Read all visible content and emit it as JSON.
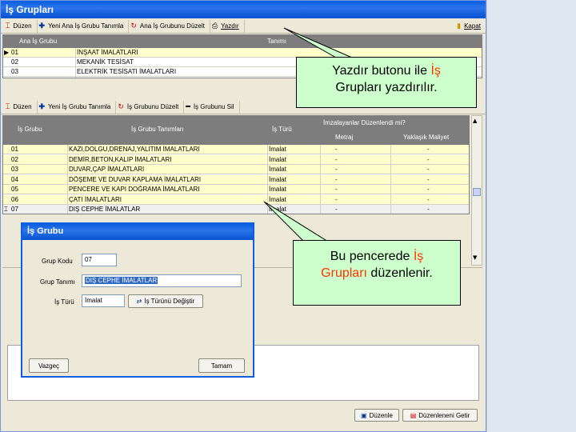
{
  "window": {
    "title": "İş Grupları"
  },
  "toolbar_top": {
    "edit": "Düzen",
    "new_main": "Yeni Ana İş Grubu Tanımla",
    "edit_main": "Ana İş Grubunu Düzelt",
    "print": "Yazdır",
    "close": "Kapat"
  },
  "main_grid": {
    "headers": [
      "Ana İş Grubu",
      "Tanımı"
    ],
    "rows": [
      {
        "code": "01",
        "name": "İNŞAAT İMALATLARI"
      },
      {
        "code": "02",
        "name": "MEKANİK TESİSAT"
      },
      {
        "code": "03",
        "name": "ELEKTRİK TESİSATI İMALATLARI"
      }
    ]
  },
  "toolbar_sub": {
    "edit": "Düzen",
    "new": "Yeni İş Grubu Tanımla",
    "edit_group": "İş Grubunu Düzelt",
    "delete": "İş Grubunu Sil"
  },
  "sub_grid": {
    "headers": {
      "code": "İş Grubu",
      "name": "İş Grubu Tanımları",
      "type": "İş Türü",
      "sign": "İmzalayanlar Düzenlendi mi?",
      "metraj": "Metraj",
      "cost": "Yaklaşık Maliyet"
    },
    "rows": [
      {
        "code": "01",
        "name": "KAZI,DOLGU,DRENAJ,YALITIM İMALATLARI",
        "type": "İmalat",
        "m": "-",
        "c": "-"
      },
      {
        "code": "02",
        "name": "DEMİR,BETON,KALIP İMALATLARI",
        "type": "İmalat",
        "m": "-",
        "c": "-"
      },
      {
        "code": "03",
        "name": "DUVAR,ÇAP İMALATLARI",
        "type": "İmalat",
        "m": "-",
        "c": "-"
      },
      {
        "code": "04",
        "name": "DÖŞEME VE DUVAR KAPLAMA İMALATLARI",
        "type": "İmalat",
        "m": "-",
        "c": "-"
      },
      {
        "code": "05",
        "name": "PENCERE VE KAPI DOĞRAMA İMALATLARI",
        "type": "İmalat",
        "m": "-",
        "c": "-"
      },
      {
        "code": "06",
        "name": "ÇATI İMALATLARI",
        "type": "İmalat",
        "m": "-",
        "c": "-"
      },
      {
        "code": "07",
        "name": "DIŞ CEPHE İMALATLAR",
        "type": "İmalat",
        "m": "-",
        "c": "-"
      }
    ]
  },
  "callout_top": {
    "part1": "Yazdır butonu ile ",
    "accent": "İş",
    "part2": "Grupları",
    "part3": " yazdırılır."
  },
  "callout_bottom": {
    "part1": "Bu pencerede ",
    "accent1": "İş",
    "accent2": "Grupları",
    "part2": " düzenlenir."
  },
  "dialog": {
    "title": "İş Grubu",
    "code_label": "Grup Kodu",
    "code_value": "07",
    "name_label": "Grup Tanımı",
    "name_value": "DIŞ CEPHE İMALATLAR",
    "type_label": "İş Türü",
    "type_value": "İmalat",
    "change_type": "İş Türünü Değiştir",
    "cancel": "Vazgeç",
    "ok": "Tamam"
  },
  "bottom_buttons": {
    "edit": "Düzenle",
    "editors": "Düzenleneni Getir"
  },
  "colors": {
    "title_blue": "#0a5fe0",
    "callout_green": "#ccffcc",
    "accent": "#ff3300",
    "grid_yellow": "#ffffcc"
  }
}
